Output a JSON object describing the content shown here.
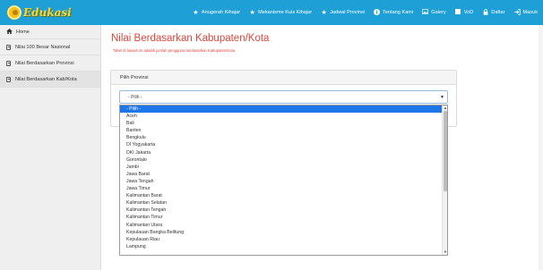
{
  "brand": {
    "logo_text": "Edukasi"
  },
  "nav": {
    "items": [
      {
        "label": "Anugerah Kihajar",
        "icon": "star-icon"
      },
      {
        "label": "Mekanisme Kuis Kihajar",
        "icon": "star-icon"
      },
      {
        "label": "Jadwal Provinsi",
        "icon": "star-icon"
      },
      {
        "label": "Tentang Kami",
        "icon": "info-icon"
      },
      {
        "label": "Galery",
        "icon": "image-icon"
      },
      {
        "label": "VoD",
        "icon": "video-icon"
      },
      {
        "label": "Daftar",
        "icon": "lock-icon"
      },
      {
        "label": "Masuk",
        "icon": "sign-in-icon"
      }
    ]
  },
  "sidebar": {
    "items": [
      {
        "label": "Home",
        "icon": "home-icon"
      },
      {
        "label": "Nilai 100 Besar Nasional",
        "icon": "document-icon"
      },
      {
        "label": "Nilai Berdasarkan Provinsi",
        "icon": "document-icon"
      },
      {
        "label": "Nilai Berdasarkan Kab/Kota",
        "icon": "document-icon"
      }
    ]
  },
  "main": {
    "title": "Nilai Berdasarkan Kabupaten/Kota",
    "subtitle": "Tabel di bawah ini adalah jumlah pengguna berdasarkan Kabupaten/Kota",
    "panel_title": "Pilih Provinsi",
    "select_value": "- Pilih -"
  },
  "dropdown": {
    "options": [
      "- Pilih -",
      "Aceh",
      "Bali",
      "Banten",
      "Bengkulu",
      "DI Yogyakarta",
      "DKI Jakarta",
      "Gorontalo",
      "Jambi",
      "Jawa Barat",
      "Jawa Tengah",
      "Jawa Timur",
      "Kalimantan Barat",
      "Kalimantan Selatan",
      "Kalimantan Tengah",
      "Kalimantan Timur",
      "Kalimantan Utara",
      "Kepulauan Bangka Belitung",
      "Kepulauan Riau",
      "Lampung"
    ],
    "selected_index": 0
  },
  "colors": {
    "topbar": "#1ea0d6",
    "title_red": "#e0453a",
    "selected_option": "#1e77e9"
  }
}
